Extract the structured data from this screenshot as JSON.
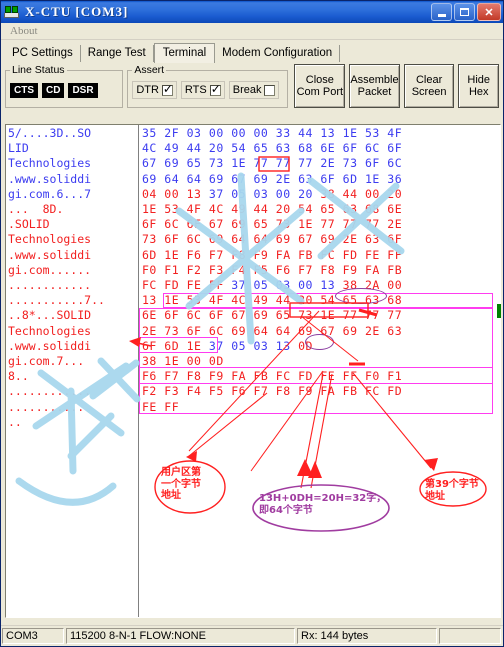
{
  "window": {
    "title": "X-CTU    [COM3]",
    "icon": "xctu-chip-icon",
    "minimize_label": "Minimize",
    "maximize_label": "Maximize",
    "close_label": "Close"
  },
  "menubar": {
    "items": [
      "About"
    ]
  },
  "tabs": [
    {
      "label": "PC Settings",
      "active": false
    },
    {
      "label": "Range Test",
      "active": false
    },
    {
      "label": "Terminal",
      "active": true
    },
    {
      "label": "Modem Configuration",
      "active": false
    }
  ],
  "toolbar": {
    "line_status": {
      "legend": "Line Status",
      "leds": [
        "CTS",
        "CD",
        "DSR"
      ]
    },
    "assert": {
      "legend": "Assert",
      "checks": [
        {
          "label": "DTR",
          "checked": true
        },
        {
          "label": "RTS",
          "checked": true
        },
        {
          "label": "Break",
          "checked": false
        }
      ]
    },
    "buttons": [
      {
        "line1": "Close",
        "line2": "Com Port"
      },
      {
        "line1": "Assemble",
        "line2": "Packet"
      },
      {
        "line1": "Clear",
        "line2": "Screen"
      },
      {
        "line1": "Hide",
        "line2": "Hex"
      }
    ]
  },
  "terminal": {
    "ascii_lines": [
      {
        "text": "5/....3D..SO",
        "color": "blue"
      },
      {
        "text": "LID",
        "color": "blue"
      },
      {
        "text": "Technologies",
        "color": "blue"
      },
      {
        "text": ".www.soliddi",
        "color": "blue"
      },
      {
        "text": "gi.com.6...7",
        "color": "blue"
      },
      {
        "text": "...  8D.",
        "color": "red"
      },
      {
        "text": ".SOLID",
        "color": "red"
      },
      {
        "text": "Technologies",
        "color": "red"
      },
      {
        "text": ".www.soliddi",
        "color": "red"
      },
      {
        "text": "gi.com......",
        "color": "red"
      },
      {
        "text": "............",
        "color": "red"
      },
      {
        "text": "...........7..",
        "color": "red"
      },
      {
        "text": "..8*...SOLID",
        "color": "red"
      },
      {
        "text": "Technologies",
        "color": "red"
      },
      {
        "text": ".www.soliddi",
        "color": "red"
      },
      {
        "text": "gi.com.7...",
        "color": "red"
      },
      {
        "text": "8..",
        "color": "red"
      },
      {
        "text": "............",
        "color": "red"
      },
      {
        "text": "...........",
        "color": "red"
      },
      {
        "text": "..",
        "color": "red"
      }
    ],
    "hex_lines": [
      {
        "bytes": [
          "35",
          "2F",
          "03",
          "00",
          "00",
          "00",
          "33",
          "44",
          "13",
          "1E",
          "53",
          "4F"
        ],
        "colors": [
          "blue",
          "blue",
          "blue",
          "blue",
          "blue",
          "blue",
          "blue",
          "blue",
          "blue",
          "blue",
          "blue",
          "blue"
        ]
      },
      {
        "bytes": [
          "4C",
          "49",
          "44",
          "20",
          "54",
          "65",
          "63",
          "68",
          "6E",
          "6F",
          "6C",
          "6F"
        ],
        "colors": [
          "blue",
          "blue",
          "blue",
          "blue",
          "blue",
          "blue",
          "blue",
          "blue",
          "blue",
          "blue",
          "blue",
          "blue"
        ]
      },
      {
        "bytes": [
          "67",
          "69",
          "65",
          "73",
          "1E",
          "77",
          "77",
          "77",
          "2E",
          "73",
          "6F",
          "6C"
        ],
        "colors": [
          "blue",
          "blue",
          "blue",
          "blue",
          "blue",
          "blue",
          "blue",
          "blue",
          "blue",
          "blue",
          "blue",
          "blue"
        ]
      },
      {
        "bytes": [
          "69",
          "64",
          "64",
          "69",
          "67",
          "69",
          "2E",
          "63",
          "6F",
          "6D",
          "1E",
          "36"
        ],
        "colors": [
          "blue",
          "blue",
          "blue",
          "blue",
          "blue",
          "blue",
          "blue",
          "blue",
          "blue",
          "blue",
          "blue",
          "blue"
        ]
      },
      {
        "bytes": [
          "04",
          "00",
          "13",
          "37",
          "05",
          "03",
          "00",
          "20",
          "38",
          "44",
          "00",
          "20"
        ],
        "colors": [
          "red",
          "red",
          "red",
          "blue",
          "blue",
          "blue",
          "blue",
          "blue",
          "red",
          "red",
          "red",
          "red"
        ]
      },
      {
        "bytes": [
          "1E",
          "53",
          "4F",
          "4C",
          "49",
          "44",
          "20",
          "54",
          "65",
          "63",
          "68",
          "6E"
        ],
        "colors": [
          "red",
          "red",
          "red",
          "red",
          "red",
          "red",
          "red",
          "red",
          "red",
          "red",
          "red",
          "red"
        ]
      },
      {
        "bytes": [
          "6F",
          "6C",
          "6F",
          "67",
          "69",
          "65",
          "73",
          "1E",
          "77",
          "77",
          "77",
          "2E"
        ],
        "colors": [
          "red",
          "red",
          "red",
          "red",
          "red",
          "red",
          "red",
          "red",
          "red",
          "red",
          "red",
          "red"
        ]
      },
      {
        "bytes": [
          "73",
          "6F",
          "6C",
          "69",
          "64",
          "64",
          "69",
          "67",
          "69",
          "2E",
          "63",
          "6F"
        ],
        "colors": [
          "red",
          "red",
          "red",
          "red",
          "red",
          "red",
          "red",
          "red",
          "red",
          "red",
          "red",
          "red"
        ]
      },
      {
        "bytes": [
          "6D",
          "1E",
          "F6",
          "F7",
          "F8",
          "F9",
          "FA",
          "FB",
          "FC",
          "FD",
          "FE",
          "FF"
        ],
        "colors": [
          "red",
          "red",
          "red",
          "red",
          "red",
          "red",
          "red",
          "red",
          "red",
          "red",
          "red",
          "red"
        ]
      },
      {
        "bytes": [
          "F0",
          "F1",
          "F2",
          "F3",
          "F4",
          "F5",
          "F6",
          "F7",
          "F8",
          "F9",
          "FA",
          "FB"
        ],
        "colors": [
          "red",
          "red",
          "red",
          "red",
          "red",
          "red",
          "red",
          "red",
          "red",
          "red",
          "red",
          "red"
        ]
      },
      {
        "bytes": [
          "FC",
          "FD",
          "FE",
          "FF",
          "37",
          "05",
          "03",
          "00",
          "13",
          "38",
          "2A",
          "00"
        ],
        "colors": [
          "red",
          "red",
          "red",
          "red",
          "blue",
          "blue",
          "blue",
          "blue",
          "blue",
          "red",
          "red",
          "red"
        ]
      },
      {
        "bytes": [
          "13",
          "1E",
          "53",
          "4F",
          "4C",
          "49",
          "44",
          "20",
          "54",
          "65",
          "63",
          "68"
        ],
        "colors": [
          "red",
          "red",
          "red",
          "red",
          "red",
          "red",
          "red",
          "red",
          "red",
          "red",
          "red",
          "red"
        ]
      },
      {
        "bytes": [
          "6E",
          "6F",
          "6C",
          "6F",
          "67",
          "69",
          "65",
          "73",
          "1E",
          "77",
          "77",
          "77"
        ],
        "colors": [
          "red",
          "red",
          "red",
          "red",
          "red",
          "red",
          "red",
          "red",
          "red",
          "red",
          "red",
          "red"
        ]
      },
      {
        "bytes": [
          "2E",
          "73",
          "6F",
          "6C",
          "69",
          "64",
          "64",
          "69",
          "67",
          "69",
          "2E",
          "63"
        ],
        "colors": [
          "red",
          "red",
          "red",
          "red",
          "red",
          "red",
          "red",
          "red",
          "red",
          "red",
          "red",
          "red"
        ]
      },
      {
        "bytes": [
          "6F",
          "6D",
          "1E",
          "37",
          "05",
          "03",
          "13",
          "0D"
        ],
        "colors": [
          "red",
          "red",
          "red",
          "blue",
          "blue",
          "blue",
          "blue",
          "red"
        ]
      },
      {
        "bytes": [
          "38",
          "1E",
          "00",
          "0D"
        ],
        "colors": [
          "red",
          "red",
          "red",
          "red"
        ]
      },
      {
        "bytes": [
          "F6",
          "F7",
          "F8",
          "F9",
          "FA",
          "FB",
          "FC",
          "FD",
          "FE",
          "FF",
          "F0",
          "F1"
        ],
        "colors": [
          "red",
          "red",
          "red",
          "red",
          "red",
          "red",
          "red",
          "red",
          "red",
          "red",
          "red",
          "red"
        ]
      },
      {
        "bytes": [
          "F2",
          "F3",
          "F4",
          "F5",
          "F6",
          "F7",
          "F8",
          "F9",
          "FA",
          "FB",
          "FC",
          "FD"
        ],
        "colors": [
          "red",
          "red",
          "red",
          "red",
          "red",
          "red",
          "red",
          "red",
          "red",
          "red",
          "red",
          "red"
        ]
      },
      {
        "bytes": [
          "FE",
          "FF"
        ],
        "colors": [
          "red",
          "red"
        ]
      }
    ]
  },
  "annotations": [
    {
      "id": "user-area-first-byte",
      "text": "用户区第\n一个字节\n地址",
      "color": "#ff2020",
      "shape": "ellipse"
    },
    {
      "id": "byte-count-calc",
      "text": "13H+0DH=20H=32字，\n即64个字节",
      "color": "#a03ca0",
      "shape": "ellipse"
    },
    {
      "id": "byte-39-address",
      "text": "第39个字节\n地址",
      "color": "#ff2020",
      "shape": "ellipse"
    }
  ],
  "watermark": {
    "text": "艾卡STUDIO",
    "color": "#a8d8ee"
  },
  "statusbar": {
    "com_port": "COM3",
    "settings": "115200 8-N-1  FLOW:NONE",
    "rx": "Rx: 144 bytes",
    "extra": ""
  }
}
